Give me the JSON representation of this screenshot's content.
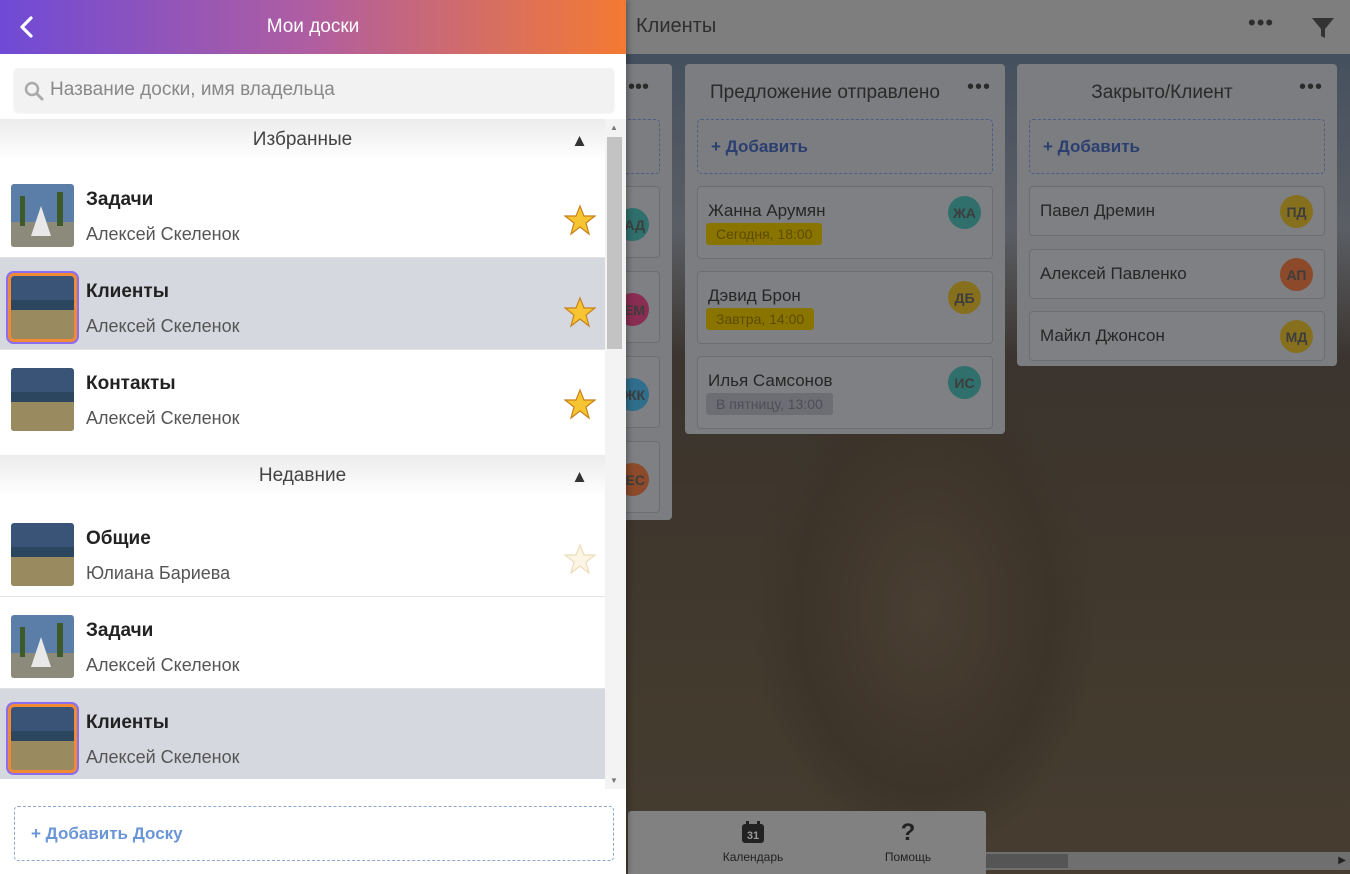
{
  "panel": {
    "title": "Мои доски",
    "search_placeholder": "Название доски, имя владельца",
    "sections": [
      {
        "label": "Избранные",
        "toggle": "▲",
        "rows": [
          {
            "title": "Задачи",
            "owner": "Алексей Скеленок",
            "thumb": "monument",
            "starred": true,
            "selected": false
          },
          {
            "title": "Клиенты",
            "owner": "Алексей Скеленок",
            "thumb": "lake",
            "starred": true,
            "selected": true
          },
          {
            "title": "Контакты",
            "owner": "Алексей Скеленок",
            "thumb": "lake",
            "starred": true,
            "selected": false
          }
        ]
      },
      {
        "label": "Недавние",
        "toggle": "▲",
        "rows": [
          {
            "title": "Общие",
            "owner": "Юлиана Бариева",
            "thumb": "lake",
            "starred": false,
            "selected": false
          },
          {
            "title": "Задачи",
            "owner": "Алексей Скеленок",
            "thumb": "monument",
            "starred": false,
            "selected": false
          },
          {
            "title": "Клиенты",
            "owner": "Алексей Скеленок",
            "thumb": "lake",
            "starred": false,
            "selected": true
          }
        ]
      }
    ],
    "add_board_label": "+ Добавить Доску"
  },
  "board": {
    "title": "Клиенты",
    "menu_dots": "•••",
    "peek_column": {
      "dots": "•••",
      "avatars": [
        "АД",
        "ЕМ",
        "ЖК",
        "ЕС"
      ],
      "avatar_colors": [
        "#2f6f6c",
        "#8a2d52",
        "#2f6e8c",
        "#8c4a2a"
      ]
    },
    "columns": [
      {
        "title": "Предложение отправлено",
        "dots": "•••",
        "add_label": "+ Добавить",
        "cards": [
          {
            "name": "Жанна Арумян",
            "badge": "Сегодня, 18:00",
            "badge_style": "yellow",
            "avatar": "ЖА",
            "avatar_color": "#2f6f6c"
          },
          {
            "name": "Дэвид Брон",
            "badge": "Завтра, 14:00",
            "badge_style": "yellow",
            "avatar": "ДБ",
            "avatar_color": "#86701e"
          },
          {
            "name": "Илья Самсонов",
            "badge": "В пятницу, 13:00",
            "badge_style": "gray",
            "avatar": "ИС",
            "avatar_color": "#2f6f6c"
          }
        ]
      },
      {
        "title": "Закрыто/Клиент",
        "dots": "•••",
        "add_label": "+ Добавить",
        "cards": [
          {
            "name": "Павел Дремин",
            "avatar": "ПД",
            "avatar_color": "#86701e"
          },
          {
            "name": "Алексей Павленко",
            "avatar": "АП",
            "avatar_color": "#8c4a2a"
          },
          {
            "name": "Майкл Джонсон",
            "avatar": "МД",
            "avatar_color": "#86701e"
          }
        ]
      }
    ],
    "bottom_bar": {
      "calendar_label": "Календарь",
      "calendar_day": "31",
      "help_label": "Помощь",
      "help_glyph": "?"
    }
  },
  "colors": {
    "header_gradient_start": "#6f4ad6",
    "header_gradient_end": "#f47a32",
    "selected_row": "#d5d8df",
    "add_link": "#6a95d6"
  }
}
